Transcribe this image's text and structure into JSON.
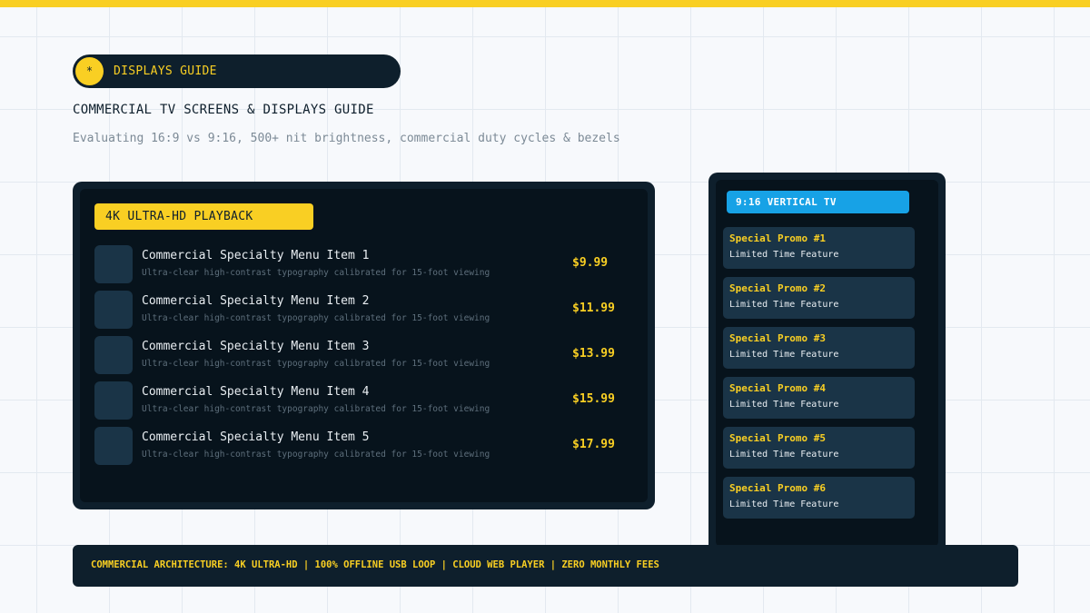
{
  "accent_color": "#f9cf23",
  "header": {
    "badge_icon": "asterisk-icon",
    "badge_icon_glyph": "*",
    "badge_label": "DISPLAYS GUIDE",
    "title": "COMMERCIAL TV SCREENS & DISPLAYS GUIDE",
    "subtitle": "Evaluating 16:9 vs 9:16, 500+ nit brightness, commercial duty cycles & bezels"
  },
  "landscape_display": {
    "tag": "4K ULTRA-HD PLAYBACK",
    "items": [
      {
        "name": "Commercial Specialty Menu Item 1",
        "description": "Ultra-clear high-contrast typography calibrated for 15-foot viewing",
        "price": "$9.99"
      },
      {
        "name": "Commercial Specialty Menu Item 2",
        "description": "Ultra-clear high-contrast typography calibrated for 15-foot viewing",
        "price": "$11.99"
      },
      {
        "name": "Commercial Specialty Menu Item 3",
        "description": "Ultra-clear high-contrast typography calibrated for 15-foot viewing",
        "price": "$13.99"
      },
      {
        "name": "Commercial Specialty Menu Item 4",
        "description": "Ultra-clear high-contrast typography calibrated for 15-foot viewing",
        "price": "$15.99"
      },
      {
        "name": "Commercial Specialty Menu Item 5",
        "description": "Ultra-clear high-contrast typography calibrated for 15-foot viewing",
        "price": "$17.99"
      }
    ]
  },
  "portrait_display": {
    "tag": "9:16 VERTICAL TV",
    "tag_color": "#17a2e6",
    "promos": [
      {
        "title": "Special Promo #1",
        "subtitle": "Limited Time Feature"
      },
      {
        "title": "Special Promo #2",
        "subtitle": "Limited Time Feature"
      },
      {
        "title": "Special Promo #3",
        "subtitle": "Limited Time Feature"
      },
      {
        "title": "Special Promo #4",
        "subtitle": "Limited Time Feature"
      },
      {
        "title": "Special Promo #5",
        "subtitle": "Limited Time Feature"
      },
      {
        "title": "Special Promo #6",
        "subtitle": "Limited Time Feature"
      }
    ]
  },
  "footer": {
    "text": "COMMERCIAL ARCHITECTURE: 4K ULTRA-HD | 100% OFFLINE USB LOOP | CLOUD WEB PLAYER | ZERO MONTHLY FEES"
  }
}
